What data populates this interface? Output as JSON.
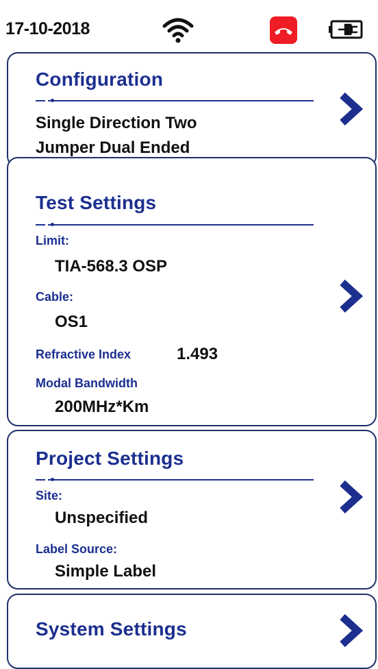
{
  "status": {
    "date": "17-10-2018",
    "icons": [
      "wifi-icon",
      "hang-up-call-icon",
      "battery-plug-icon"
    ],
    "call_color": "#ee1c24"
  },
  "configuration": {
    "title": "Configuration",
    "value_line1": "Single Direction Two",
    "value_line2": "Jumper Dual Ended"
  },
  "test_settings": {
    "title": "Test Settings",
    "limit_label": "Limit:",
    "limit_value": "TIA-568.3 OSP",
    "cable_label": "Cable:",
    "cable_value": "OS1",
    "refractive_index_label": "Refractive Index",
    "refractive_index_value": "1.493",
    "modal_bandwidth_label": "Modal Bandwidth",
    "modal_bandwidth_value": "200MHz*Km"
  },
  "project_settings": {
    "title": "Project Settings",
    "site_label": "Site:",
    "site_value": "Unspecified",
    "label_source_label": "Label Source:",
    "label_source_value": "Simple Label"
  },
  "system_settings": {
    "title": "System Settings"
  },
  "colors": {
    "accent": "#1c2f8f",
    "border": "#1f2f67"
  }
}
